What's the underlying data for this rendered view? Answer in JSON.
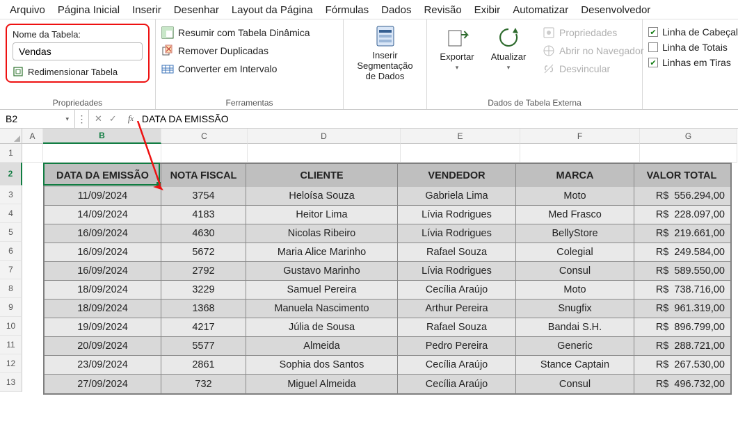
{
  "tabs": [
    "Arquivo",
    "Página Inicial",
    "Inserir",
    "Desenhar",
    "Layout da Página",
    "Fórmulas",
    "Dados",
    "Revisão",
    "Exibir",
    "Automatizar",
    "Desenvolvedor"
  ],
  "ribbon": {
    "props": {
      "title": "Nome da Tabela:",
      "table_name": "Vendas",
      "resize": "Redimensionar Tabela",
      "group_label": "Propriedades"
    },
    "tools": {
      "pivot": "Resumir com Tabela Dinâmica",
      "dupes": "Remover Duplicadas",
      "convert": "Converter em Intervalo",
      "group_label": "Ferramentas"
    },
    "slicer": {
      "line1": "Inserir Segmentação",
      "line2": "de Dados"
    },
    "external": {
      "export": "Exportar",
      "refresh": "Atualizar",
      "props": "Propriedades",
      "browser": "Abrir no Navegador",
      "unlink": "Desvincular",
      "group_label": "Dados de Tabela Externa"
    },
    "styleopts": {
      "header": "Linha de Cabeçalho",
      "total": "Linha de Totais",
      "banded": "Linhas em Tiras"
    }
  },
  "namebox": "B2",
  "formula": "DATA DA EMISSÃO",
  "columns": [
    "A",
    "B",
    "C",
    "D",
    "E",
    "F",
    "G"
  ],
  "row_numbers": [
    "1",
    "2",
    "3",
    "4",
    "5",
    "6",
    "7",
    "8",
    "9",
    "10",
    "11",
    "12",
    "13"
  ],
  "table": {
    "headers": [
      "DATA DA EMISSÃO",
      "NOTA FISCAL",
      "CLIENTE",
      "VENDEDOR",
      "MARCA",
      "VALOR TOTAL"
    ],
    "rows": [
      [
        "11/09/2024",
        "3754",
        "Heloísa Souza",
        "Gabriela Lima",
        "Moto",
        "R$  556.294,00"
      ],
      [
        "14/09/2024",
        "4183",
        "Heitor Lima",
        "Lívia Rodrigues",
        "Med Frasco",
        "R$  228.097,00"
      ],
      [
        "16/09/2024",
        "4630",
        "Nicolas Ribeiro",
        "Lívia Rodrigues",
        "BellyStore",
        "R$  219.661,00"
      ],
      [
        "16/09/2024",
        "5672",
        "Maria Alice Marinho",
        "Rafael Souza",
        "Colegial",
        "R$  249.584,00"
      ],
      [
        "16/09/2024",
        "2792",
        "Gustavo Marinho",
        "Lívia Rodrigues",
        "Consul",
        "R$  589.550,00"
      ],
      [
        "18/09/2024",
        "3229",
        "Samuel Pereira",
        "Cecília Araújo",
        "Moto",
        "R$  738.716,00"
      ],
      [
        "18/09/2024",
        "1368",
        "Manuela Nascimento",
        "Arthur Pereira",
        "Snugfix",
        "R$  961.319,00"
      ],
      [
        "19/09/2024",
        "4217",
        "Júlia de Sousa",
        "Rafael Souza",
        "Bandai S.H.",
        "R$  896.799,00"
      ],
      [
        "20/09/2024",
        "5577",
        "Almeida",
        "Pedro Pereira",
        "Generic",
        "R$  288.721,00"
      ],
      [
        "23/09/2024",
        "2861",
        "Sophia dos Santos",
        "Cecília Araújo",
        "Stance Captain",
        "R$  267.530,00"
      ],
      [
        "27/09/2024",
        "732",
        "Miguel Almeida",
        "Cecília Araújo",
        "Consul",
        "R$  496.732,00"
      ]
    ]
  }
}
